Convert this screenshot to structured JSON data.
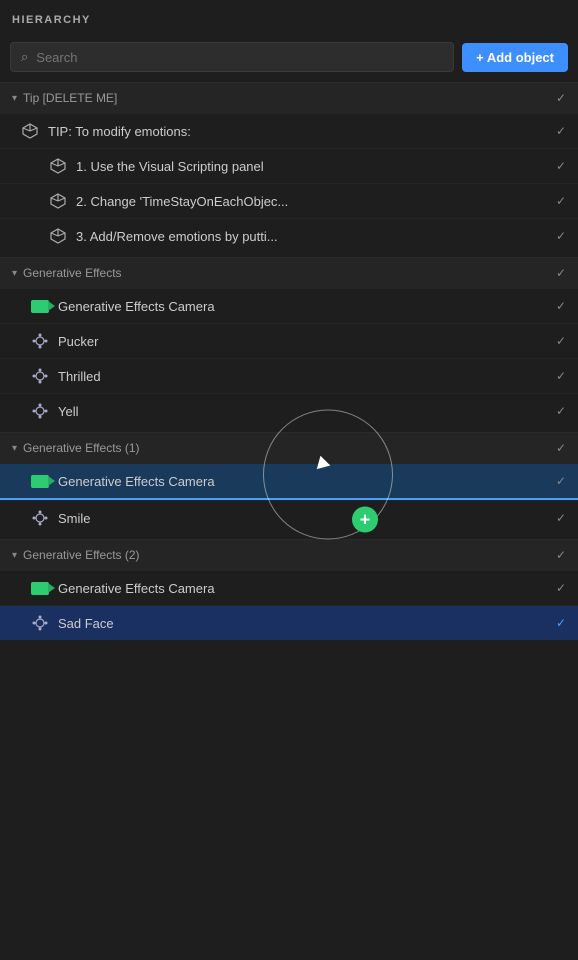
{
  "panel": {
    "title": "HIERARCHY",
    "search_placeholder": "Search",
    "add_button_label": "+ Add object"
  },
  "sections": [
    {
      "id": "tip-delete",
      "label": "Tip [DELETE ME]",
      "collapsed": false,
      "children": [
        {
          "id": "tip-modify",
          "label": "TIP: To modify emotions:",
          "icon": "cube",
          "indent": 1,
          "children": [
            {
              "id": "tip-1",
              "label": "1. Use the Visual Scripting panel",
              "icon": "cube",
              "indent": 2
            },
            {
              "id": "tip-2",
              "label": "2. Change 'TimeStayOnEachObjec...",
              "icon": "cube",
              "indent": 2
            },
            {
              "id": "tip-3",
              "label": "3. Add/Remove emotions by putti...",
              "icon": "cube",
              "indent": 2
            }
          ]
        }
      ]
    },
    {
      "id": "generative-effects",
      "label": "Generative Effects",
      "collapsed": false,
      "children": [
        {
          "id": "ge-camera",
          "label": "Generative Effects Camera",
          "icon": "camera"
        },
        {
          "id": "pucker",
          "label": "Pucker",
          "icon": "particle"
        },
        {
          "id": "thrilled",
          "label": "Thrilled",
          "icon": "particle"
        },
        {
          "id": "yell",
          "label": "Yell",
          "icon": "particle"
        }
      ]
    },
    {
      "id": "generative-effects-1",
      "label": "Generative Effects (1)",
      "collapsed": false,
      "children": [
        {
          "id": "ge1-camera",
          "label": "Generative Effects Camera",
          "icon": "camera",
          "is_drag_source": true
        },
        {
          "id": "smile",
          "label": "Smile",
          "icon": "particle",
          "is_drop_target": true
        }
      ]
    },
    {
      "id": "generative-effects-2",
      "label": "Generative Effects (2)",
      "collapsed": false,
      "children": [
        {
          "id": "ge2-camera",
          "label": "Generative Effects Camera",
          "icon": "camera"
        },
        {
          "id": "sad-face",
          "label": "Sad Face",
          "icon": "particle",
          "selected": true
        }
      ]
    }
  ],
  "icons": {
    "check": "✓",
    "chevron_down": "▾",
    "search": "🔍",
    "plus": "+"
  }
}
